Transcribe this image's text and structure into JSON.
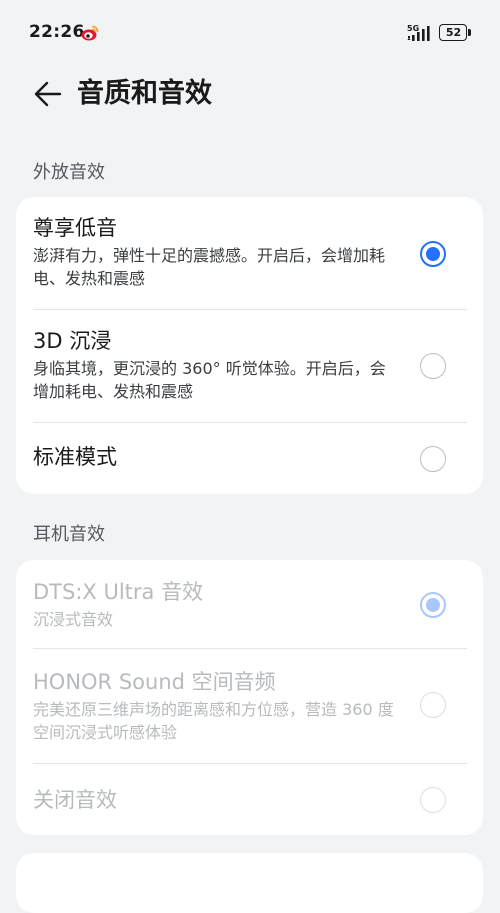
{
  "status_bar": {
    "time": "22:26",
    "network": "5G",
    "battery": "52",
    "notification_icon": "weibo-icon"
  },
  "header": {
    "back_icon": "arrow-left-icon",
    "title": "音质和音效"
  },
  "speaker_section": {
    "label": "外放音效",
    "options": [
      {
        "title": "尊享低音",
        "desc": "澎湃有力，弹性十足的震撼感。开启后，会增加耗电、发热和震感",
        "selected": true
      },
      {
        "title": "3D 沉浸",
        "desc": "身临其境，更沉浸的 360° 听觉体验。开启后，会增加耗电、发热和震感",
        "selected": false
      },
      {
        "title": "标准模式",
        "desc": "",
        "selected": false
      }
    ]
  },
  "headphone_section": {
    "label": "耳机音效",
    "disabled": true,
    "options": [
      {
        "title": "DTS:X Ultra 音效",
        "desc": "沉浸式音效",
        "selected": true
      },
      {
        "title": "HONOR Sound 空间音频",
        "desc": "完美还原三维声场的距离感和方位感，营造 360 度空间沉浸式听感体验",
        "selected": false
      },
      {
        "title": "关闭音效",
        "desc": "",
        "selected": false
      }
    ]
  },
  "colors": {
    "accent": "#256fff",
    "accent_disabled": "#a9c6ff",
    "background": "#f1f3f5",
    "card": "#ffffff"
  }
}
